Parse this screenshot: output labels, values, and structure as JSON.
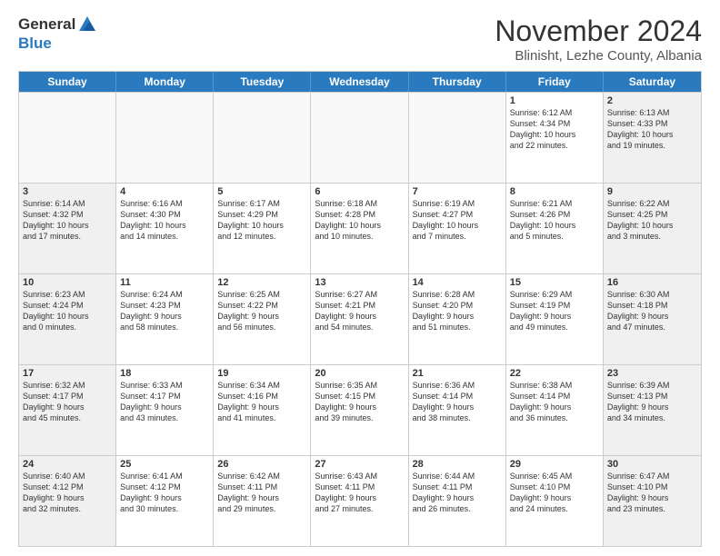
{
  "logo": {
    "general": "General",
    "blue": "Blue"
  },
  "title": "November 2024",
  "location": "Blinisht, Lezhe County, Albania",
  "days": [
    "Sunday",
    "Monday",
    "Tuesday",
    "Wednesday",
    "Thursday",
    "Friday",
    "Saturday"
  ],
  "weeks": [
    [
      {
        "day": "",
        "info": ""
      },
      {
        "day": "",
        "info": ""
      },
      {
        "day": "",
        "info": ""
      },
      {
        "day": "",
        "info": ""
      },
      {
        "day": "",
        "info": ""
      },
      {
        "day": "1",
        "info": "Sunrise: 6:12 AM\nSunset: 4:34 PM\nDaylight: 10 hours and 22 minutes."
      },
      {
        "day": "2",
        "info": "Sunrise: 6:13 AM\nSunset: 4:33 PM\nDaylight: 10 hours and 19 minutes."
      }
    ],
    [
      {
        "day": "3",
        "info": "Sunrise: 6:14 AM\nSunset: 4:32 PM\nDaylight: 10 hours and 17 minutes."
      },
      {
        "day": "4",
        "info": "Sunrise: 6:16 AM\nSunset: 4:30 PM\nDaylight: 10 hours and 14 minutes."
      },
      {
        "day": "5",
        "info": "Sunrise: 6:17 AM\nSunset: 4:29 PM\nDaylight: 10 hours and 12 minutes."
      },
      {
        "day": "6",
        "info": "Sunrise: 6:18 AM\nSunset: 4:28 PM\nDaylight: 10 hours and 10 minutes."
      },
      {
        "day": "7",
        "info": "Sunrise: 6:19 AM\nSunset: 4:27 PM\nDaylight: 10 hours and 7 minutes."
      },
      {
        "day": "8",
        "info": "Sunrise: 6:21 AM\nSunset: 4:26 PM\nDaylight: 10 hours and 5 minutes."
      },
      {
        "day": "9",
        "info": "Sunrise: 6:22 AM\nSunset: 4:25 PM\nDaylight: 10 hours and 3 minutes."
      }
    ],
    [
      {
        "day": "10",
        "info": "Sunrise: 6:23 AM\nSunset: 4:24 PM\nDaylight: 10 hours and 0 minutes."
      },
      {
        "day": "11",
        "info": "Sunrise: 6:24 AM\nSunset: 4:23 PM\nDaylight: 9 hours and 58 minutes."
      },
      {
        "day": "12",
        "info": "Sunrise: 6:25 AM\nSunset: 4:22 PM\nDaylight: 9 hours and 56 minutes."
      },
      {
        "day": "13",
        "info": "Sunrise: 6:27 AM\nSunset: 4:21 PM\nDaylight: 9 hours and 54 minutes."
      },
      {
        "day": "14",
        "info": "Sunrise: 6:28 AM\nSunset: 4:20 PM\nDaylight: 9 hours and 51 minutes."
      },
      {
        "day": "15",
        "info": "Sunrise: 6:29 AM\nSunset: 4:19 PM\nDaylight: 9 hours and 49 minutes."
      },
      {
        "day": "16",
        "info": "Sunrise: 6:30 AM\nSunset: 4:18 PM\nDaylight: 9 hours and 47 minutes."
      }
    ],
    [
      {
        "day": "17",
        "info": "Sunrise: 6:32 AM\nSunset: 4:17 PM\nDaylight: 9 hours and 45 minutes."
      },
      {
        "day": "18",
        "info": "Sunrise: 6:33 AM\nSunset: 4:17 PM\nDaylight: 9 hours and 43 minutes."
      },
      {
        "day": "19",
        "info": "Sunrise: 6:34 AM\nSunset: 4:16 PM\nDaylight: 9 hours and 41 minutes."
      },
      {
        "day": "20",
        "info": "Sunrise: 6:35 AM\nSunset: 4:15 PM\nDaylight: 9 hours and 39 minutes."
      },
      {
        "day": "21",
        "info": "Sunrise: 6:36 AM\nSunset: 4:14 PM\nDaylight: 9 hours and 38 minutes."
      },
      {
        "day": "22",
        "info": "Sunrise: 6:38 AM\nSunset: 4:14 PM\nDaylight: 9 hours and 36 minutes."
      },
      {
        "day": "23",
        "info": "Sunrise: 6:39 AM\nSunset: 4:13 PM\nDaylight: 9 hours and 34 minutes."
      }
    ],
    [
      {
        "day": "24",
        "info": "Sunrise: 6:40 AM\nSunset: 4:12 PM\nDaylight: 9 hours and 32 minutes."
      },
      {
        "day": "25",
        "info": "Sunrise: 6:41 AM\nSunset: 4:12 PM\nDaylight: 9 hours and 30 minutes."
      },
      {
        "day": "26",
        "info": "Sunrise: 6:42 AM\nSunset: 4:11 PM\nDaylight: 9 hours and 29 minutes."
      },
      {
        "day": "27",
        "info": "Sunrise: 6:43 AM\nSunset: 4:11 PM\nDaylight: 9 hours and 27 minutes."
      },
      {
        "day": "28",
        "info": "Sunrise: 6:44 AM\nSunset: 4:11 PM\nDaylight: 9 hours and 26 minutes."
      },
      {
        "day": "29",
        "info": "Sunrise: 6:45 AM\nSunset: 4:10 PM\nDaylight: 9 hours and 24 minutes."
      },
      {
        "day": "30",
        "info": "Sunrise: 6:47 AM\nSunset: 4:10 PM\nDaylight: 9 hours and 23 minutes."
      }
    ]
  ]
}
